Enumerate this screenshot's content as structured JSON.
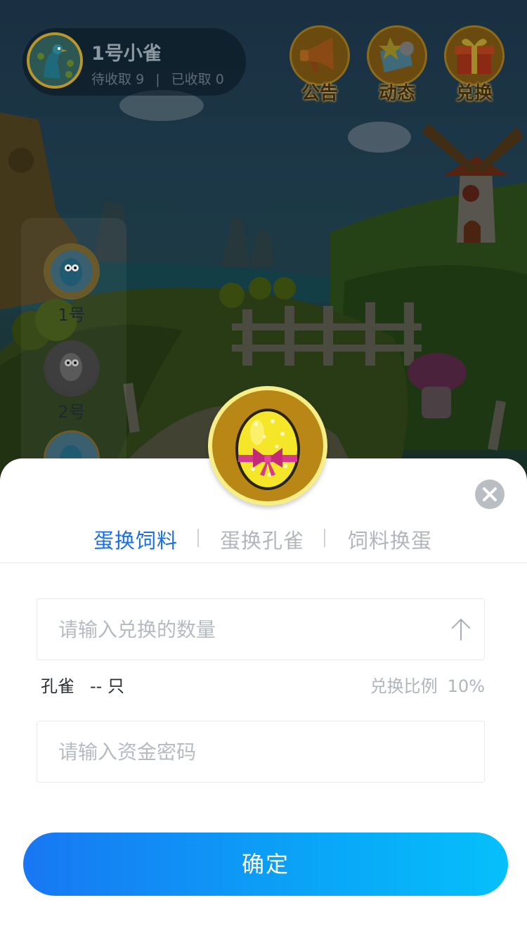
{
  "user": {
    "name": "1号小雀",
    "pending_label": "待收取",
    "pending_count": "9",
    "collected_label": "已收取",
    "collected_count": "0"
  },
  "top_actions": [
    {
      "label": "公告",
      "icon": "megaphone-icon"
    },
    {
      "label": "动态",
      "icon": "news-icon"
    },
    {
      "label": "兑换",
      "icon": "gift-icon"
    }
  ],
  "side_list": [
    {
      "label": "1号"
    },
    {
      "label": "2号"
    }
  ],
  "sheet": {
    "badge_icon": "egg-icon",
    "tabs": [
      {
        "label": "蛋换饲料",
        "active": true
      },
      {
        "label": "蛋换孔雀",
        "active": false
      },
      {
        "label": "饲料换蛋",
        "active": false
      }
    ],
    "amount_placeholder": "请输入兑换的数量",
    "info": {
      "item_label": "孔雀",
      "item_count": "-- 只",
      "rate_label": "兑换比例",
      "rate_value": "10%"
    },
    "password_placeholder": "请输入资金密码",
    "confirm_label": "确定"
  },
  "colors": {
    "accent": "#1a6fe8",
    "button_gradient_start": "#1877f3",
    "button_gradient_end": "#05c0fb",
    "inactive_tab": "#b1b6bc",
    "badge_gold": "#b98716"
  }
}
